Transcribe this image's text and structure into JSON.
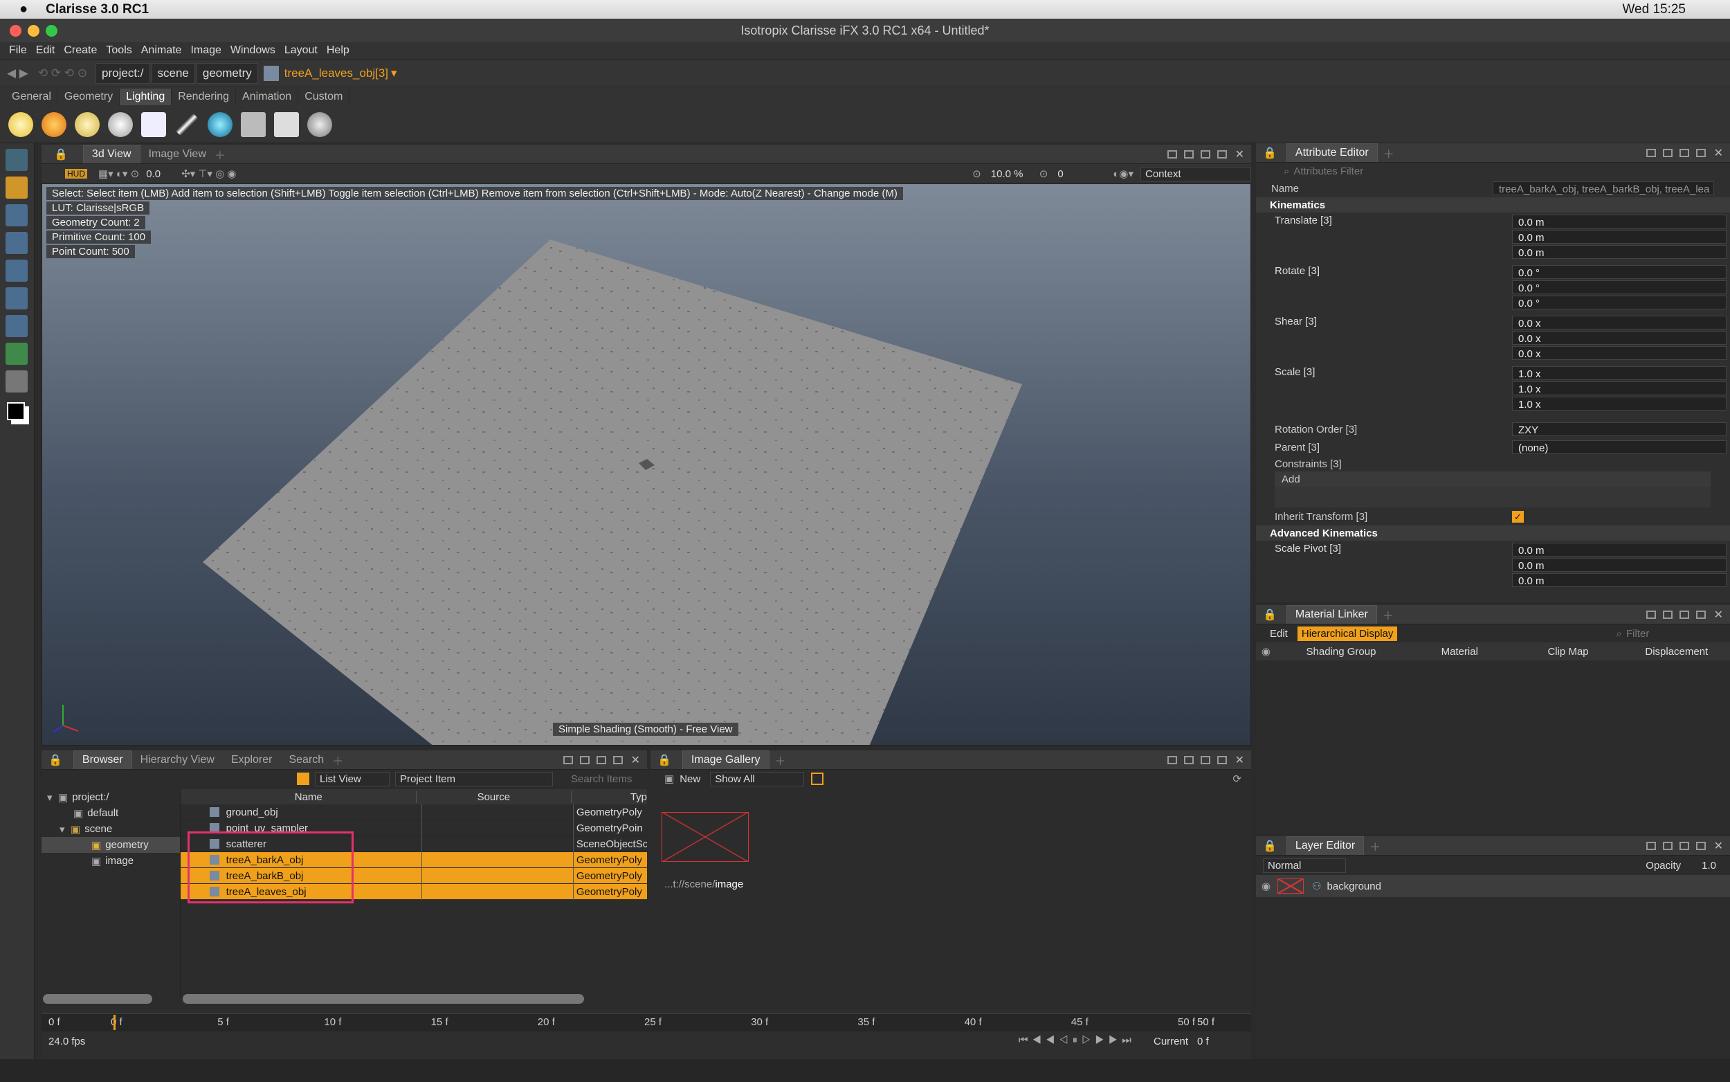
{
  "macbar": {
    "app": "Clarisse 3.0 RC1",
    "clock": "Wed 15:25"
  },
  "window": {
    "title": "Isotropix Clarisse iFX 3.0 RC1 x64  - Untitled*"
  },
  "menu": [
    "File",
    "Edit",
    "Create",
    "Tools",
    "Animate",
    "Image",
    "Windows",
    "Layout",
    "Help"
  ],
  "path": {
    "crumbs": [
      "project:/",
      "scene",
      "geometry"
    ],
    "current": "treeA_leaves_obj[3]"
  },
  "shelf_tabs": [
    "General",
    "Geometry",
    "Lighting",
    "Rendering",
    "Animation",
    "Custom"
  ],
  "shelf_active": "Lighting",
  "viewport": {
    "tabs": [
      "3d View",
      "Image View"
    ],
    "toolbar": {
      "field1": "0.0",
      "zoom": "10.0 %",
      "frame": "0",
      "context": "Context"
    },
    "help": "Select: Select item (LMB)  Add item to selection (Shift+LMB)  Toggle item selection (Ctrl+LMB)  Remove item from selection (Ctrl+Shift+LMB)  - Mode: Auto(Z Nearest) - Change mode (M)",
    "stats": [
      "LUT: Clarisse|sRGB",
      "Geometry Count: 2",
      "Primitive Count: 100",
      "Point Count: 500"
    ],
    "shading": "Simple Shading (Smooth) - Free View"
  },
  "attr": {
    "title": "Attribute Editor",
    "filter": "Attributes Filter",
    "name_label": "Name",
    "name_value": "treeA_barkA_obj, treeA_barkB_obj, treeA_lea",
    "kinematics": "Kinematics",
    "translate": {
      "label": "Translate [3]",
      "v": [
        "0.0 m",
        "0.0 m",
        "0.0 m"
      ]
    },
    "rotate": {
      "label": "Rotate [3]",
      "v": [
        "0.0 °",
        "0.0 °",
        "0.0 °"
      ]
    },
    "shear": {
      "label": "Shear [3]",
      "v": [
        "0.0 x",
        "0.0 x",
        "0.0 x"
      ]
    },
    "scale": {
      "label": "Scale [3]",
      "v": [
        "1.0 x",
        "1.0 x",
        "1.0 x"
      ]
    },
    "rotorder": {
      "label": "Rotation Order [3]",
      "v": "ZXY"
    },
    "parent": {
      "label": "Parent [3]",
      "v": "(none)"
    },
    "constraints": "Constraints [3]",
    "add": "Add",
    "inherit": "Inherit Transform [3]",
    "adv": "Advanced Kinematics",
    "pivot": {
      "label": "Scale Pivot [3]",
      "v": [
        "0.0 m",
        "0.0 m",
        "0.0 m"
      ]
    }
  },
  "matlink": {
    "title": "Material Linker",
    "edit": "Edit",
    "hier": "Hierarchical Display",
    "filter": "Filter",
    "cols": [
      "Shading Group",
      "Material",
      "Clip Map",
      "Displacement"
    ]
  },
  "layer": {
    "title": "Layer Editor",
    "mode": "Normal",
    "opacity_label": "Opacity",
    "opacity": "1.0",
    "item": "background"
  },
  "browser": {
    "tabs": [
      "Browser",
      "Hierarchy View",
      "Explorer",
      "Search"
    ],
    "view": "List View",
    "type": "Project Item",
    "search": "Search Items",
    "tree": [
      "project:/",
      "default",
      "scene",
      "geometry",
      "image"
    ],
    "cols": [
      "Name",
      "Source",
      "Typ"
    ],
    "rows": [
      {
        "name": "ground_obj",
        "type": "GeometryPoly"
      },
      {
        "name": "point_uv_sampler",
        "type": "GeometryPoin"
      },
      {
        "name": "scatterer",
        "type": "SceneObjectSc"
      },
      {
        "name": "treeA_barkA_obj",
        "type": "GeometryPoly"
      },
      {
        "name": "treeA_barkB_obj",
        "type": "GeometryPoly"
      },
      {
        "name": "treeA_leaves_obj",
        "type": "GeometryPoly"
      }
    ]
  },
  "gallery": {
    "title": "Image Gallery",
    "new": "New",
    "show": "Show All",
    "path_prefix": "...t://scene/",
    "path_name": "image"
  },
  "timeline": {
    "start": "0 f",
    "end": "50 f",
    "ticks": [
      "0 f",
      "5 f",
      "10 f",
      "15 f",
      "20 f",
      "25 f",
      "30 f",
      "35 f",
      "40 f",
      "45 f",
      "50 f"
    ],
    "fps": "24.0 fps",
    "current_label": "Current",
    "current": "0 f"
  }
}
